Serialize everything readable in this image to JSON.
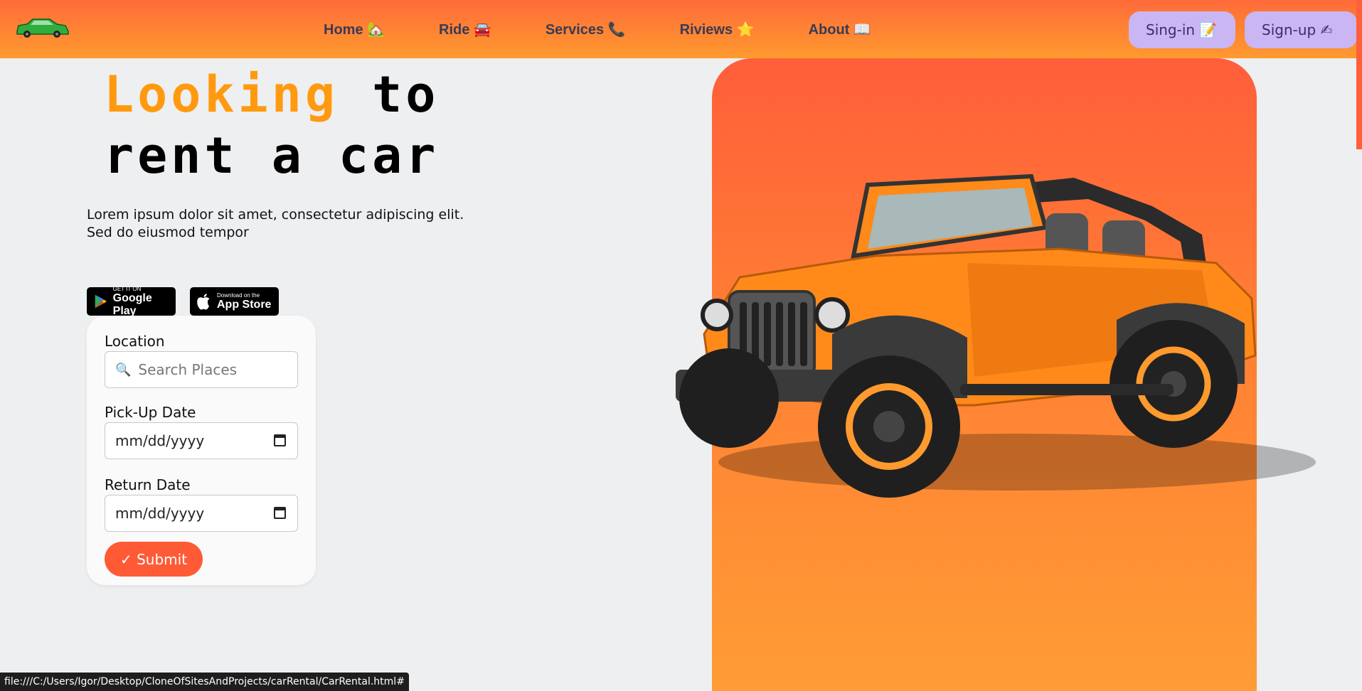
{
  "nav": {
    "links": [
      {
        "label": "Home 🏡"
      },
      {
        "label": "Ride 🚘"
      },
      {
        "label": "Services 📞"
      },
      {
        "label": "Riviews ⭐"
      },
      {
        "label": "About 📖"
      }
    ],
    "signin_label": "Sing-in 📝",
    "signup_label": "Sign-up ✍"
  },
  "hero": {
    "headline_accent": "Looking",
    "headline_rest_1": " to",
    "headline_rest_2": "rent a car",
    "subtext": "Lorem ipsum dolor sit amet, consectetur adipiscing elit. Sed do eiusmod tempor",
    "badges": {
      "google_small": "GET IT ON",
      "google_big": "Google Play",
      "apple_small": "Download on the",
      "apple_big": "App Store"
    }
  },
  "form": {
    "location_label": "Location",
    "location_placeholder": "Search Places",
    "pickup_label": "Pick-Up Date",
    "pickup_value": "mm/dd/yyyy",
    "return_label": "Return Date",
    "return_value": "mm/dd/yyyy",
    "submit_label": "✓ Submit"
  },
  "status_bar": "file:///C:/Users/Igor/Desktop/CloneOfSitesAndProjects/carRental/CarRental.html#",
  "colors": {
    "nav_top": "#ff6b3a",
    "nav_bottom": "#ff9a2e",
    "accent_text": "#ff9a10",
    "button_purple": "#c9b6f2",
    "submit": "#ff5a36",
    "car_body": "#ff8a1a"
  }
}
